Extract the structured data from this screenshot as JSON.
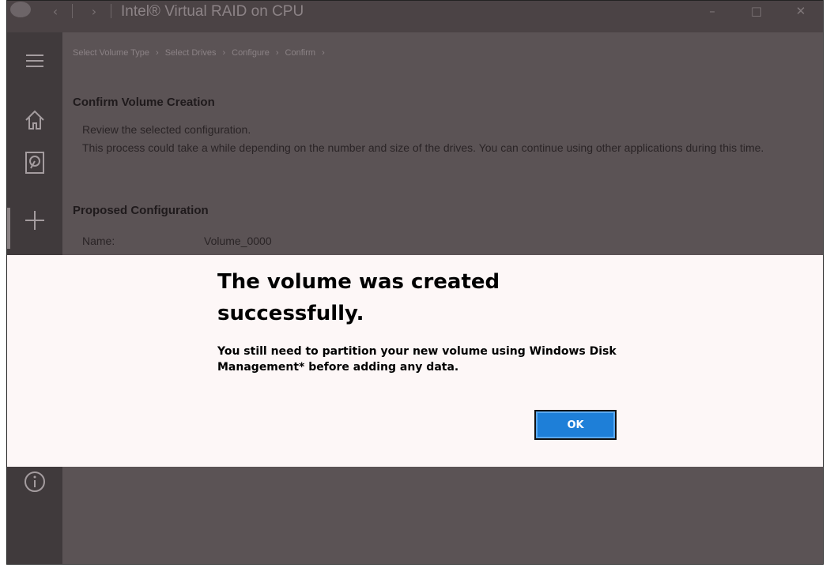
{
  "window": {
    "title": "Intel® Virtual RAID on CPU",
    "back_icon": "back-arrow-icon",
    "forward_icon": "forward-arrow-icon",
    "controls": [
      "minimize-icon",
      "maximize-icon",
      "close-icon"
    ]
  },
  "rail": {
    "items": [
      "hamburger-menu-icon",
      "home-icon",
      "disk-icon",
      "add-icon",
      "info-icon"
    ]
  },
  "breadcrumb": {
    "steps": [
      "Select Volume Type",
      "Select Drives",
      "Configure",
      "Confirm"
    ]
  },
  "confirm": {
    "heading": "Confirm Volume Creation",
    "line1": "Review the selected configuration.",
    "line2": "This process could take a while depending on the number and size of the drives. You can continue using other applications during this time."
  },
  "proposed": {
    "heading": "Proposed Configuration",
    "name_label": "Name:",
    "name_value": "Volume_0000"
  },
  "dialog": {
    "title": "The volume was created successfully.",
    "message": "You still need to partition your new volume using Windows Disk Management* before adding any data.",
    "ok_label": "OK",
    "ok_color": "#1e7fd8"
  }
}
